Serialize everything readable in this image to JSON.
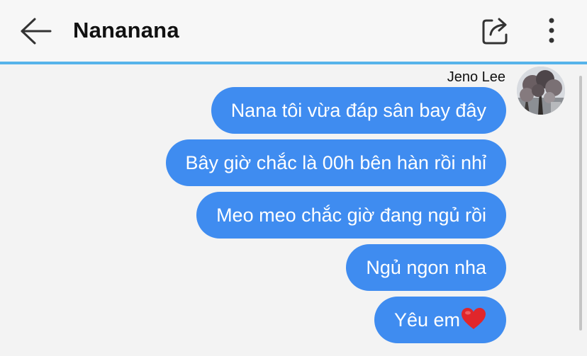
{
  "header": {
    "title": "Nananana"
  },
  "icons": {
    "back": "arrow-left-icon",
    "share": "share-icon",
    "more": "more-vertical-icon",
    "heart": "heart-emoji-icon"
  },
  "chat": {
    "sender_name": "Jeno Lee",
    "messages": [
      {
        "text": "Nana tôi vừa đáp sân bay đây"
      },
      {
        "text": "Bây giờ chắc là 00h bên hàn rồi nhỉ"
      },
      {
        "text": "Meo meo chắc giờ đang ngủ rồi"
      },
      {
        "text": "Ngủ ngon nha"
      },
      {
        "text": "Yêu em"
      }
    ]
  },
  "colors": {
    "bubble": "#3f8cf0",
    "accent_line": "#56b3ea",
    "background": "#f3f3f3"
  }
}
